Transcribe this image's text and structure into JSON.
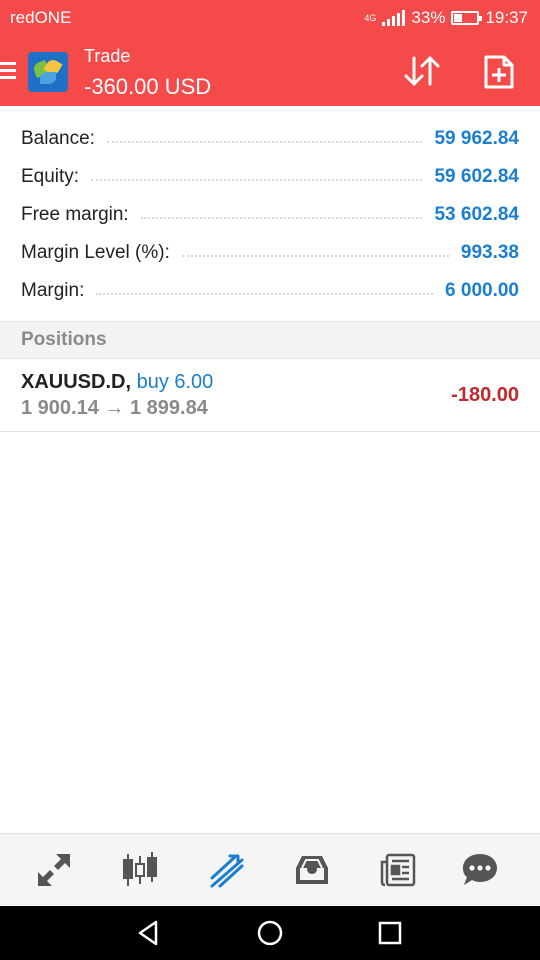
{
  "status_bar": {
    "carrier": "redONE",
    "network": "4G",
    "battery": "33%",
    "time": "19:37"
  },
  "header": {
    "title": "Trade",
    "subtitle": "-360.00 USD"
  },
  "account": [
    {
      "label": "Balance:",
      "value": "59 962.84"
    },
    {
      "label": "Equity:",
      "value": "59 602.84"
    },
    {
      "label": "Free margin:",
      "value": "53 602.84"
    },
    {
      "label": "Margin Level (%):",
      "value": "993.38"
    },
    {
      "label": "Margin:",
      "value": "6 000.00"
    }
  ],
  "positions_section": {
    "label": "Positions"
  },
  "position": {
    "symbol": "XAUUSD.D,",
    "direction": "buy 6.00",
    "prices": "1 900.14 → 1 899.84",
    "profit": "-180.00"
  },
  "tabs": [
    {
      "icon": "quotes-icon",
      "active": false
    },
    {
      "icon": "chart-icon",
      "active": false
    },
    {
      "icon": "trade-icon",
      "active": true
    },
    {
      "icon": "history-icon",
      "active": false
    },
    {
      "icon": "news-icon",
      "active": false
    },
    {
      "icon": "chat-icon",
      "active": false
    }
  ],
  "colors": {
    "header_red": "#f44a4a",
    "value_blue": "#1a7fd0",
    "loss_red": "#c0282d",
    "active_tab": "#1a7fd0",
    "inactive_tab": "#555555"
  }
}
